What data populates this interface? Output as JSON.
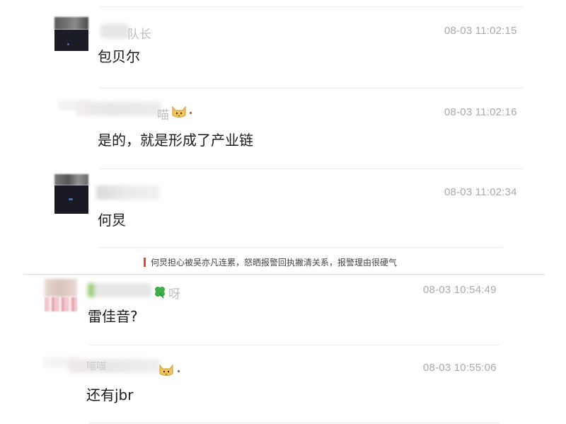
{
  "caption": "何炅担心被吴亦凡连累，怒晒报警回执撇清关系，报警理由很硬气",
  "messages_top": [
    {
      "name_suffix": "队长",
      "time": "08-03 11:02:15",
      "content": "包贝尔"
    },
    {
      "name_suffix": "喵",
      "time": "08-03 11:02:16",
      "content": "是的，就是形成了产业链"
    },
    {
      "name_suffix": "",
      "time": "08-03 11:02:34",
      "content": "何炅"
    }
  ],
  "messages_bottom": [
    {
      "name_suffix": "呀",
      "time": "08-03 10:54:49",
      "content": "雷佳音?"
    },
    {
      "name_suffix": "喵喵",
      "time": "08-03 10:55:06",
      "content": "还有jbr"
    }
  ],
  "colors": {
    "caption_accent": "#e2452c",
    "time_text": "#a9a9a9",
    "divider": "#ececec"
  }
}
